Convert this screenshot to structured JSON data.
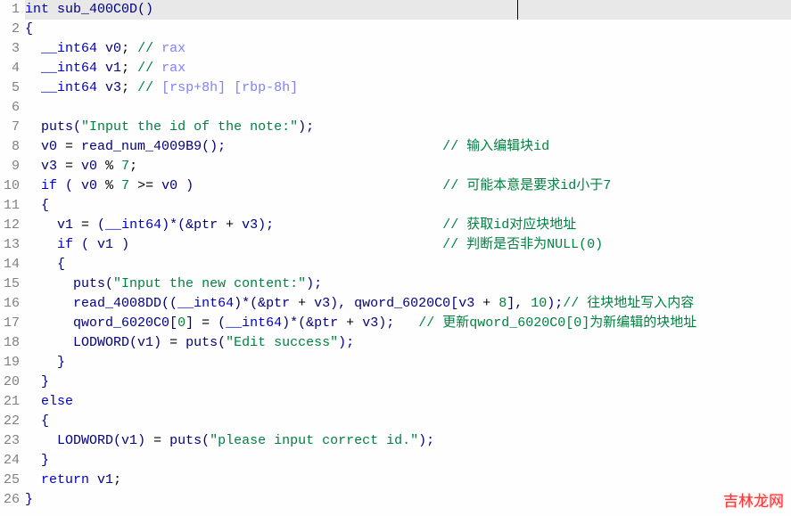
{
  "watermark": "吉林龙网",
  "line_count": 26,
  "lines": {
    "1": {
      "ret_type": "int",
      "func_name": "sub_400C0D",
      "paren": "()"
    },
    "2": {
      "text": "{"
    },
    "3": {
      "indent": "  ",
      "type": "__int64",
      "var": "v0",
      "sep": "; ",
      "comm_pre": "// ",
      "annot": "rax"
    },
    "4": {
      "indent": "  ",
      "type": "__int64",
      "var": "v1",
      "sep": "; ",
      "comm_pre": "// ",
      "annot": "rax"
    },
    "5": {
      "indent": "  ",
      "type": "__int64",
      "var": "v3",
      "sep": "; ",
      "comm_pre": "// ",
      "annot": "[rsp+8h] [rbp-8h]"
    },
    "7": {
      "indent": "  ",
      "fn": "puts",
      "open": "(",
      "str": "\"Input the id of the note:\"",
      "close": ");"
    },
    "8": {
      "indent": "  ",
      "lhs": "v0",
      "eq": " = ",
      "call": "read_num_4009B9",
      "tail": "();",
      "gap": "                           ",
      "comment": "// 输入编辑块id"
    },
    "9": {
      "indent": "  ",
      "lhs": "v3",
      "eq": " = ",
      "a": "v0",
      "op": " % ",
      "b": "7",
      "semi": ";"
    },
    "10": {
      "indent": "  ",
      "kw": "if",
      "open": " ( ",
      "a": "v0",
      "op": " % ",
      "n": "7",
      "cmp": " >= ",
      "b": "v0",
      "close": " )",
      "gap": "                               ",
      "comment": "// 可能本意是要求id小于7"
    },
    "11": {
      "text": "  {"
    },
    "12": {
      "indent": "    ",
      "lhs": "v1",
      "eq": " = ",
      "open": "(",
      "cast": "__int64",
      "close_cast": ")",
      "deref": "*(&",
      "ptr": "ptr",
      "plus": " + ",
      "v": "v3",
      "end": ");",
      "gap": "                     ",
      "comment": "// 获取id对应块地址"
    },
    "13": {
      "indent": "    ",
      "kw": "if",
      "open": " ( ",
      "v": "v1",
      "close": " )",
      "gap": "                                       ",
      "comment": "// 判断是否非为NULL(0)"
    },
    "14": {
      "text": "    {"
    },
    "15": {
      "indent": "      ",
      "fn": "puts",
      "open": "(",
      "str": "\"Input the new content:\"",
      "close": ");"
    },
    "16": {
      "indent": "      ",
      "fn": "read_4008DD",
      "open": "((",
      "cast": "__int64",
      "mid": ")*(&",
      "ptr": "ptr",
      "plus": " + ",
      "v": "v3",
      "after": "), ",
      "arr": "qword_6020C0",
      "br": "[",
      "idx_v": "v3",
      "idx_plus": " + ",
      "idx_n": "8",
      "br2": "], ",
      "n10": "10",
      "close": ");",
      "comment": "// 往块地址写入内容"
    },
    "17": {
      "indent": "      ",
      "arr": "qword_6020C0",
      "idx": "[",
      "zero": "0",
      "idx2": "]",
      "eq": " = ",
      "open": "(",
      "cast": "__int64",
      "mid": ")*(&",
      "ptr": "ptr",
      "plus": " + ",
      "v": "v3",
      "close": ");",
      "gap": "   ",
      "comment": "// 更新qword_6020C0[0]为新编辑的块地址"
    },
    "18": {
      "indent": "      ",
      "macro": "LODWORD",
      "open": "(",
      "v": "v1",
      "close_a": ")",
      "eq": " = ",
      "fn": "puts",
      "open2": "(",
      "str": "\"Edit success\"",
      "close": ");"
    },
    "19": {
      "text": "    }"
    },
    "20": {
      "text": "  }"
    },
    "21": {
      "indent": "  ",
      "kw": "else"
    },
    "22": {
      "text": "  {"
    },
    "23": {
      "indent": "    ",
      "macro": "LODWORD",
      "open": "(",
      "v": "v1",
      "close_a": ")",
      "eq": " = ",
      "fn": "puts",
      "open2": "(",
      "str": "\"please input correct id.\"",
      "close": ");"
    },
    "24": {
      "text": "  }"
    },
    "25": {
      "indent": "  ",
      "kw": "return",
      "sp": " ",
      "v": "v1",
      "semi": ";"
    },
    "26": {
      "text": "}"
    }
  }
}
